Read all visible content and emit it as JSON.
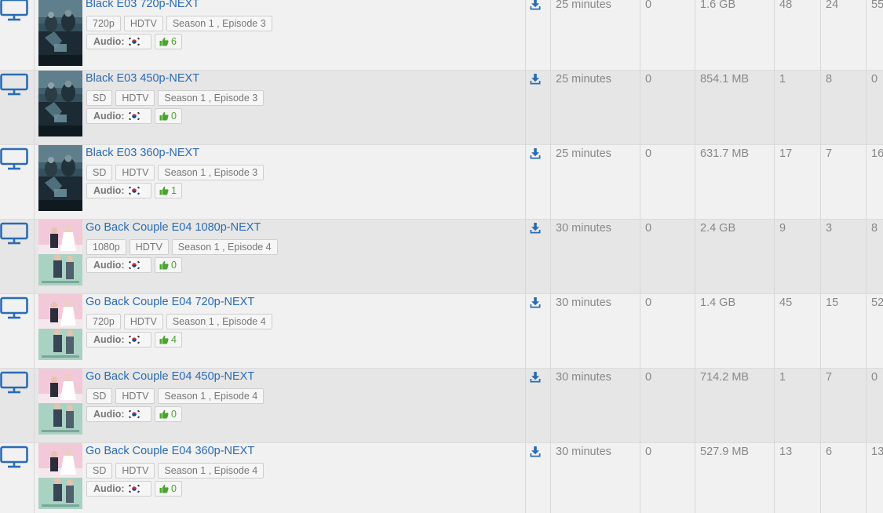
{
  "rows": [
    {
      "poster": "black",
      "title": "Black E03 720p-NEXT",
      "quality": "720p",
      "source": "HDTV",
      "episode": "Season 1 , Episode 3",
      "audio_label": "Audio:",
      "audio_flag": "south-korea-flag-icon",
      "likes": "6",
      "duration": "25 minutes",
      "comments": "0",
      "size": "1.6 GB",
      "seeders": "48",
      "leechers": "24",
      "completed": "55"
    },
    {
      "poster": "black",
      "title": "Black E03 450p-NEXT",
      "quality": "SD",
      "source": "HDTV",
      "episode": "Season 1 , Episode 3",
      "audio_label": "Audio:",
      "audio_flag": "south-korea-flag-icon",
      "likes": "0",
      "duration": "25 minutes",
      "comments": "0",
      "size": "854.1 MB",
      "seeders": "1",
      "leechers": "8",
      "completed": "0"
    },
    {
      "poster": "black",
      "title": "Black E03 360p-NEXT",
      "quality": "SD",
      "source": "HDTV",
      "episode": "Season 1 , Episode 3",
      "audio_label": "Audio:",
      "audio_flag": "south-korea-flag-icon",
      "likes": "1",
      "duration": "25 minutes",
      "comments": "0",
      "size": "631.7 MB",
      "seeders": "17",
      "leechers": "7",
      "completed": "16"
    },
    {
      "poster": "couple",
      "title": "Go Back Couple E04 1080p-NEXT",
      "quality": "1080p",
      "source": "HDTV",
      "episode": "Season 1 , Episode 4",
      "audio_label": "Audio:",
      "audio_flag": "south-korea-flag-icon",
      "likes": "0",
      "duration": "30 minutes",
      "comments": "0",
      "size": "2.4 GB",
      "seeders": "9",
      "leechers": "3",
      "completed": "8"
    },
    {
      "poster": "couple",
      "title": "Go Back Couple E04 720p-NEXT",
      "quality": "720p",
      "source": "HDTV",
      "episode": "Season 1 , Episode 4",
      "audio_label": "Audio:",
      "audio_flag": "south-korea-flag-icon",
      "likes": "4",
      "duration": "30 minutes",
      "comments": "0",
      "size": "1.4 GB",
      "seeders": "45",
      "leechers": "15",
      "completed": "52"
    },
    {
      "poster": "couple",
      "title": "Go Back Couple E04 450p-NEXT",
      "quality": "SD",
      "source": "HDTV",
      "episode": "Season 1 , Episode 4",
      "audio_label": "Audio:",
      "audio_flag": "south-korea-flag-icon",
      "likes": "0",
      "duration": "30 minutes",
      "comments": "0",
      "size": "714.2 MB",
      "seeders": "1",
      "leechers": "7",
      "completed": "0"
    },
    {
      "poster": "couple",
      "title": "Go Back Couple E04 360p-NEXT",
      "quality": "SD",
      "source": "HDTV",
      "episode": "Season 1 , Episode 4",
      "audio_label": "Audio:",
      "audio_flag": "south-korea-flag-icon",
      "likes": "0",
      "duration": "30 minutes",
      "comments": "0",
      "size": "527.9 MB",
      "seeders": "13",
      "leechers": "6",
      "completed": "13"
    }
  ],
  "colors": {
    "link": "#2a6bb5",
    "icon": "#2a6bb5",
    "likes": "#4aa52c",
    "row_odd": "#f1f1f1",
    "row_even": "#e6e6e6"
  },
  "icons": {
    "category": "tv-monitor-icon",
    "download": "download-icon",
    "likes": "thumbs-up-icon"
  }
}
